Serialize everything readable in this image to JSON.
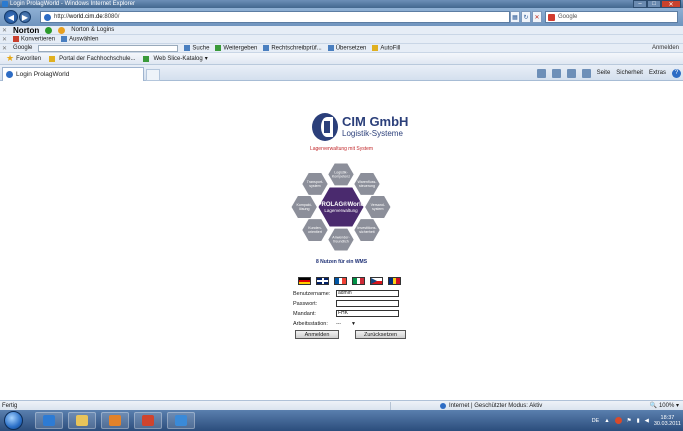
{
  "window": {
    "title": "Login ProlagWorld - Windows Internet Explorer",
    "minimize": "–",
    "maximize": "□",
    "close": "✕"
  },
  "address_bar": {
    "url_prefix": "http://",
    "url_host": "world.cim.de",
    "url_suffix": ":8080/",
    "search_placeholder": "Google"
  },
  "toolbars": {
    "norton_label": "Norton",
    "norton_safe": "Norton & Logins",
    "convert_label": "Konvertieren",
    "select_label": "Auswählen",
    "google_label": "Google",
    "suche": "Suche",
    "weitergeben": "Weitergeben",
    "rechtschreib": "Rechtschreibprüf...",
    "uebersetzen": "Übersetzen",
    "autofill": "AutoFill",
    "anmelden": "Anmelden"
  },
  "favorites": {
    "favoriten": "Favoriten",
    "portal": "Portal der Fachhochschule...",
    "slice": "Web Slice-Katalog"
  },
  "tab": {
    "title": "Login ProlagWorld"
  },
  "command_bar": {
    "seite": "Seite",
    "sicherheit": "Sicherheit",
    "extras": "Extras"
  },
  "page": {
    "logo_name": "CIM GmbH",
    "logo_sub": "Logistik-Systeme",
    "tagline": "Lagerverwaltung mit System",
    "hex_center_title": "PROLAG®World",
    "hex_center_sub": "Lagerverwaltung",
    "hex_labels": [
      "Logistik-Kompetenz",
      "Warenfluss-steuerung",
      "Versand-system",
      "Investitions-sicherheit",
      "Anwender-freundlich",
      "Kunden-orientiert",
      "Kompakt-lösung",
      "Transport-system"
    ],
    "nutzen": "8 Nutzen für ein WMS",
    "flags": [
      {
        "name": "de-flag",
        "colors": [
          "#000000",
          "#dd0000",
          "#ffce00"
        ],
        "dir": "h"
      },
      {
        "name": "uk-flag",
        "colors": [
          "#012169",
          "#ffffff",
          "#c8102e"
        ],
        "dir": "uk"
      },
      {
        "name": "fr-flag",
        "colors": [
          "#0055a4",
          "#ffffff",
          "#ef4135"
        ],
        "dir": "v"
      },
      {
        "name": "it-flag",
        "colors": [
          "#009246",
          "#ffffff",
          "#ce2b37"
        ],
        "dir": "v"
      },
      {
        "name": "cz-flag",
        "colors": [
          "#ffffff",
          "#d7141a",
          "#11457e"
        ],
        "dir": "cz"
      },
      {
        "name": "ro-flag",
        "colors": [
          "#002b7f",
          "#fcd116",
          "#ce1126"
        ],
        "dir": "v"
      }
    ],
    "form": {
      "username_label": "Benutzername:",
      "username_value": "admin",
      "password_label": "Passwort:",
      "password_value": "",
      "mandant_label": "Mandant:",
      "mandant_value": "FHK",
      "station_label": "Arbeitsstation:",
      "station_value": "---",
      "login_button": "Anmelden",
      "reset_button": "Zurücksetzen"
    }
  },
  "status_bar": {
    "status": "Fertig",
    "zone": "Internet | Geschützter Modus: Aktiv",
    "zoom": "100%"
  },
  "taskbar": {
    "clock_time": "18:37",
    "clock_date": "30.03.2011",
    "locale": "DE"
  }
}
